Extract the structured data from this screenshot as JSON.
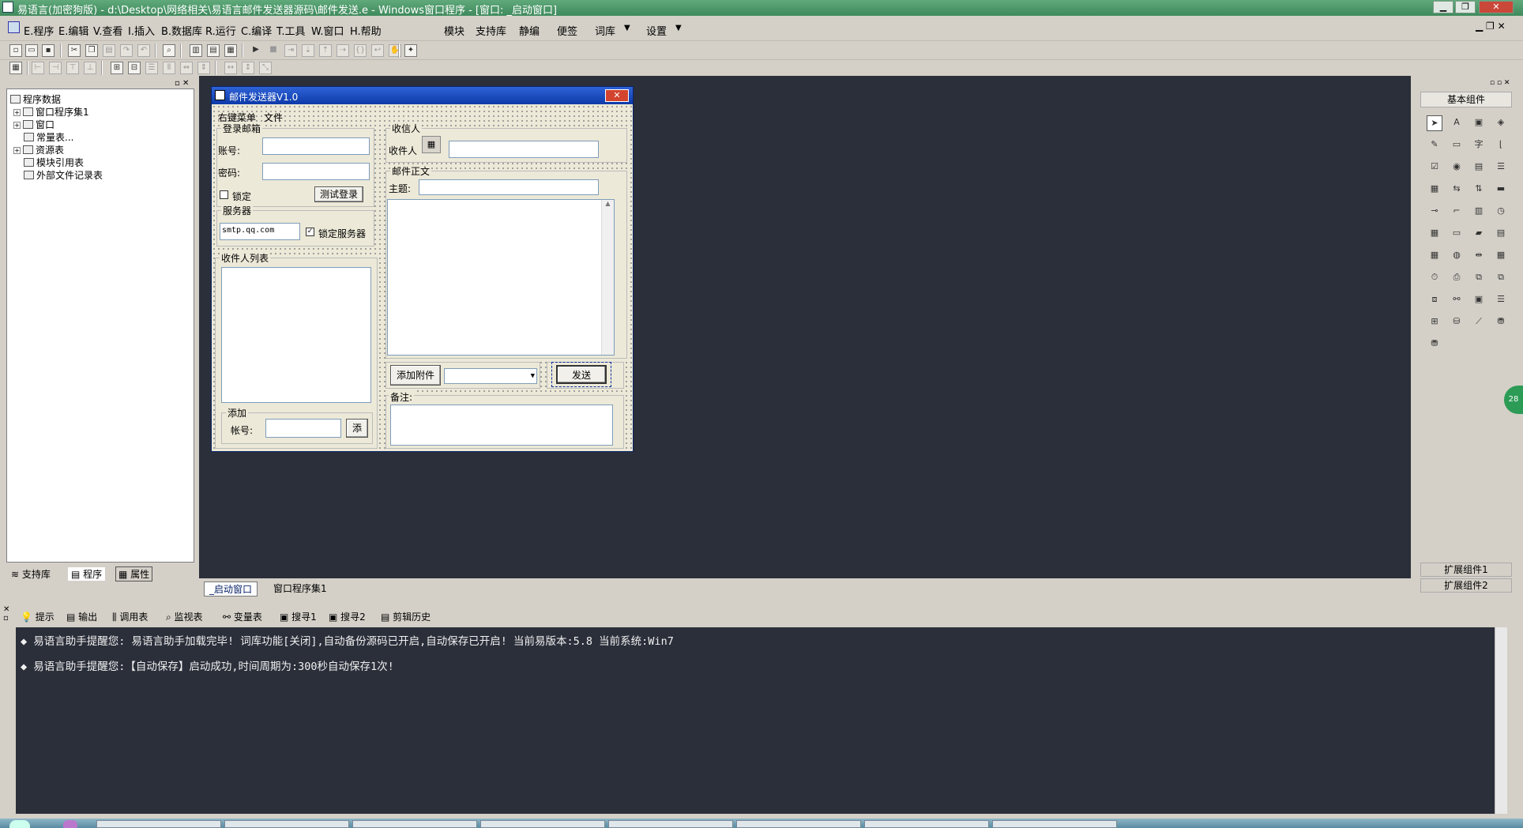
{
  "window": {
    "title": "易语言(加密狗版) - d:\\Desktop\\网络相关\\易语言邮件发送器源码\\邮件发送.e - Windows窗口程序 - [窗口: _启动窗口]"
  },
  "menu": {
    "items": [
      "E.程序",
      "E.编辑",
      "V.查看",
      "I.插入",
      "B.数据库",
      "R.运行",
      "C.编译",
      "T.工具",
      "W.窗口",
      "H.帮助"
    ],
    "extra": [
      "模块",
      "支持库",
      "静编",
      "便签",
      "词库",
      "设置"
    ]
  },
  "tree": {
    "root": "程序数据",
    "items": [
      "窗口程序集1",
      "窗口",
      "常量表...",
      "资源表",
      "模块引用表",
      "外部文件记录表"
    ]
  },
  "lefttabs": [
    "支持库",
    "程序",
    "属性"
  ],
  "form": {
    "title": "邮件发送器V1.0",
    "menu": [
      "右键菜单",
      "文件"
    ],
    "login_group": "登录邮箱",
    "account_label": "账号:",
    "password_label": "密码:",
    "lock_label": "锁定",
    "test_login": "测试登录",
    "server_group": "服务器",
    "server_value": "smtp.qq.com",
    "lock_server": "锁定服务器",
    "recipients_group": "收件人列表",
    "add_group": "添加",
    "add_account_label": "帐号:",
    "add_button": "添",
    "receiver_group": "收信人",
    "receiver_label": "收件人",
    "body_group": "邮件正文",
    "subject_label": "主题:",
    "attach_button": "添加附件",
    "send_button": "发送",
    "note_label": "备注:"
  },
  "doctabs": [
    "_启动窗口",
    "窗口程序集1"
  ],
  "right": {
    "header": "基本组件",
    "ext1": "扩展组件1",
    "ext2": "扩展组件2",
    "badge": "28"
  },
  "bottomtabs": [
    "提示",
    "输出",
    "调用表",
    "监视表",
    "变量表",
    "搜寻1",
    "搜寻2",
    "剪辑历史"
  ],
  "output": [
    "易语言助手提醒您:  易语言助手加载完毕! 词库功能[关闭],自动备份源码已开启,自动保存已开启! 当前易版本:5.8  当前系统:Win7",
    "易语言助手提醒您:【自动保存】启动成功,时间周期为:300秒自动保存1次!"
  ]
}
